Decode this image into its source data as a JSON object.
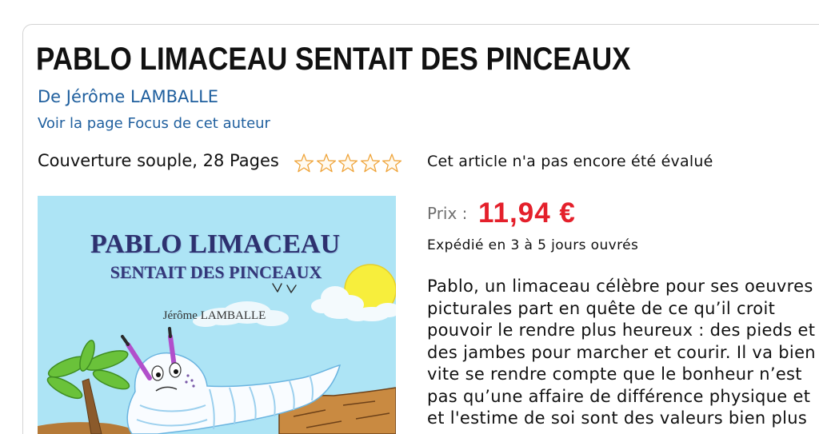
{
  "product": {
    "title": "PABLO LIMACEAU SENTAIT DES PINCEAUX",
    "author_link": "De Jérôme LAMBALLE",
    "author_focus_link": "Voir la page Focus de cet auteur",
    "format": "Couverture souple, 28 Pages",
    "rating": {
      "value": 0,
      "max": 5
    },
    "rating_text": "Cet article n'a pas encore été évalué",
    "price_label": "Prix :",
    "price": "11,94 €",
    "shipping": "Expédié en 3 à 5 jours ouvrés",
    "description_lines": [
      "Pablo, un limaceau célèbre pour ses oeuvres",
      "picturales part en quête de ce qu’il croit",
      "pouvoir le rendre plus heureux : des pieds et",
      "des jambes pour marcher et courir. Il va bien",
      "vite se rendre compte que le bonheur n’est",
      "pas qu’une affaire de différence physique et",
      "et l'estime de soi sont des valeurs bien plus"
    ]
  },
  "cover": {
    "title": "PABLO LIMACEAU",
    "subtitle": "SENTAIT DES PINCEAUX",
    "author": "Jérôme LAMBALLE"
  },
  "colors": {
    "link": "#1f5f9e",
    "price": "#e4202b",
    "text": "#111111",
    "muted": "#6f6f6f",
    "card_border": "#d4d4d4",
    "star_outline": "#efa43a",
    "star_filled": "#f5a623",
    "star_empty": "#fffaf0"
  }
}
